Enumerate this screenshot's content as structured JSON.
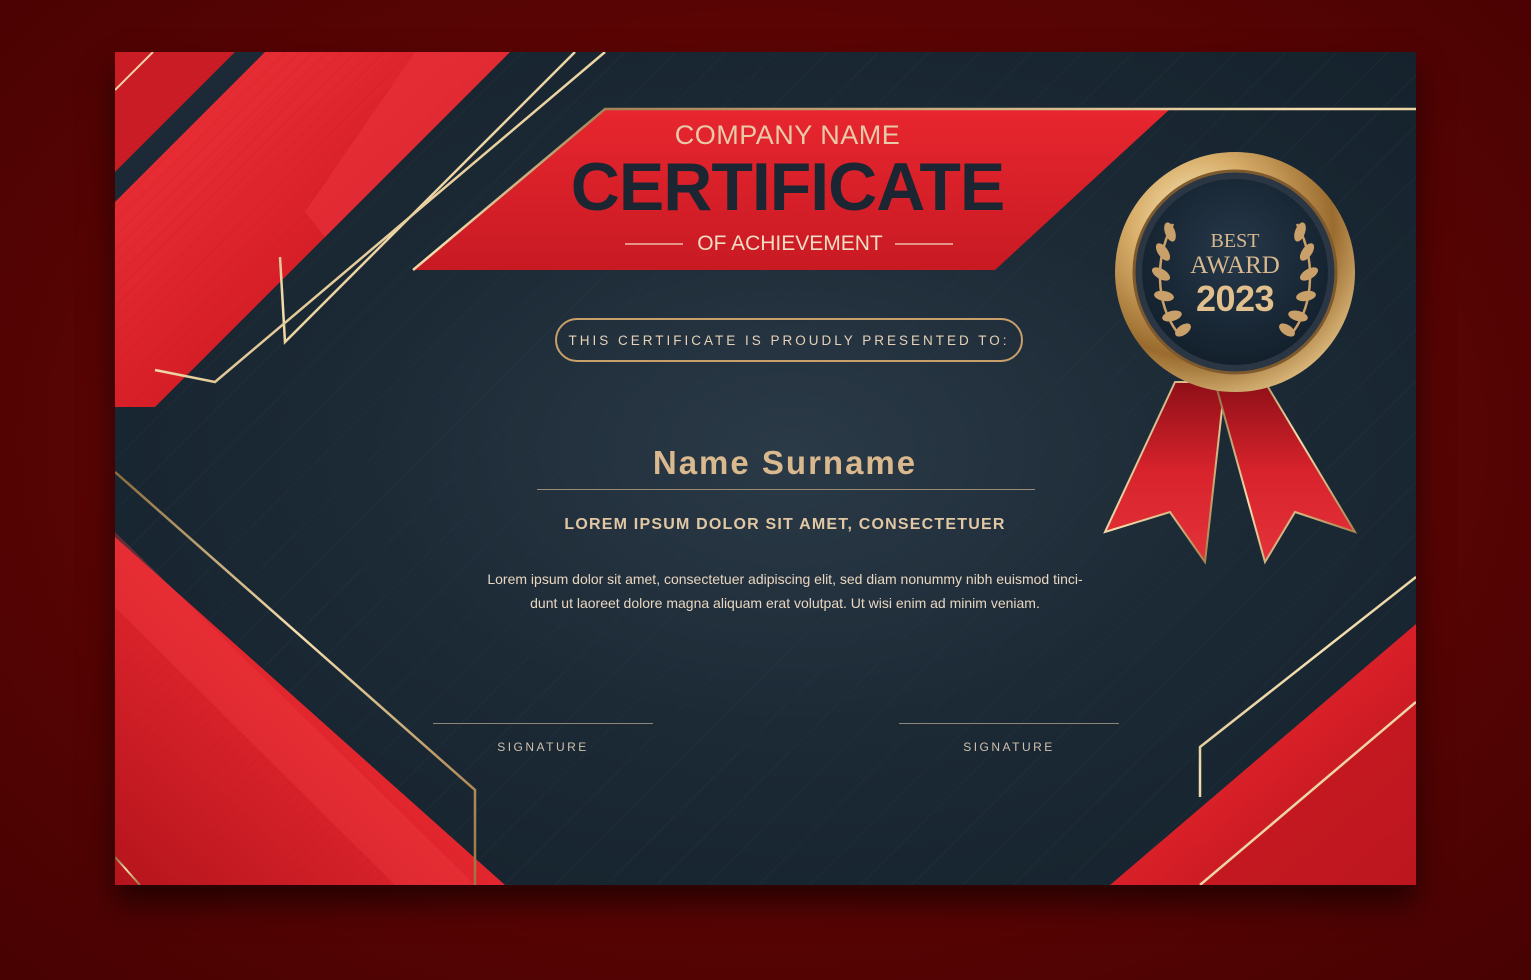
{
  "certificate": {
    "company": "COMPANY NAME",
    "title": "CERTIFICATE",
    "subtitle": "OF ACHIEVEMENT",
    "presented_to": "THIS CERTIFICATE IS PROUDLY PRESENTED TO:",
    "recipient_name": "Name Surname",
    "headline": "LOREM IPSUM DOLOR SIT AMET, CONSECTETUER",
    "body_line_1": "Lorem ipsum dolor sit amet, consectetuer adipiscing elit, sed diam nonummy nibh euismod tinci-",
    "body_line_2": "dunt ut laoreet dolore magna aliquam erat volutpat. Ut wisi enim ad minim veniam.",
    "signatures": [
      "SIGNATURE",
      "SIGNATURE"
    ]
  },
  "badge": {
    "line1": "BEST",
    "line2": "AWARD",
    "year": "2023"
  },
  "colors": {
    "background": "#5a0404",
    "card_navy": "#1c2a36",
    "accent_red": "#d9222b",
    "gold": "#c9a06a"
  }
}
